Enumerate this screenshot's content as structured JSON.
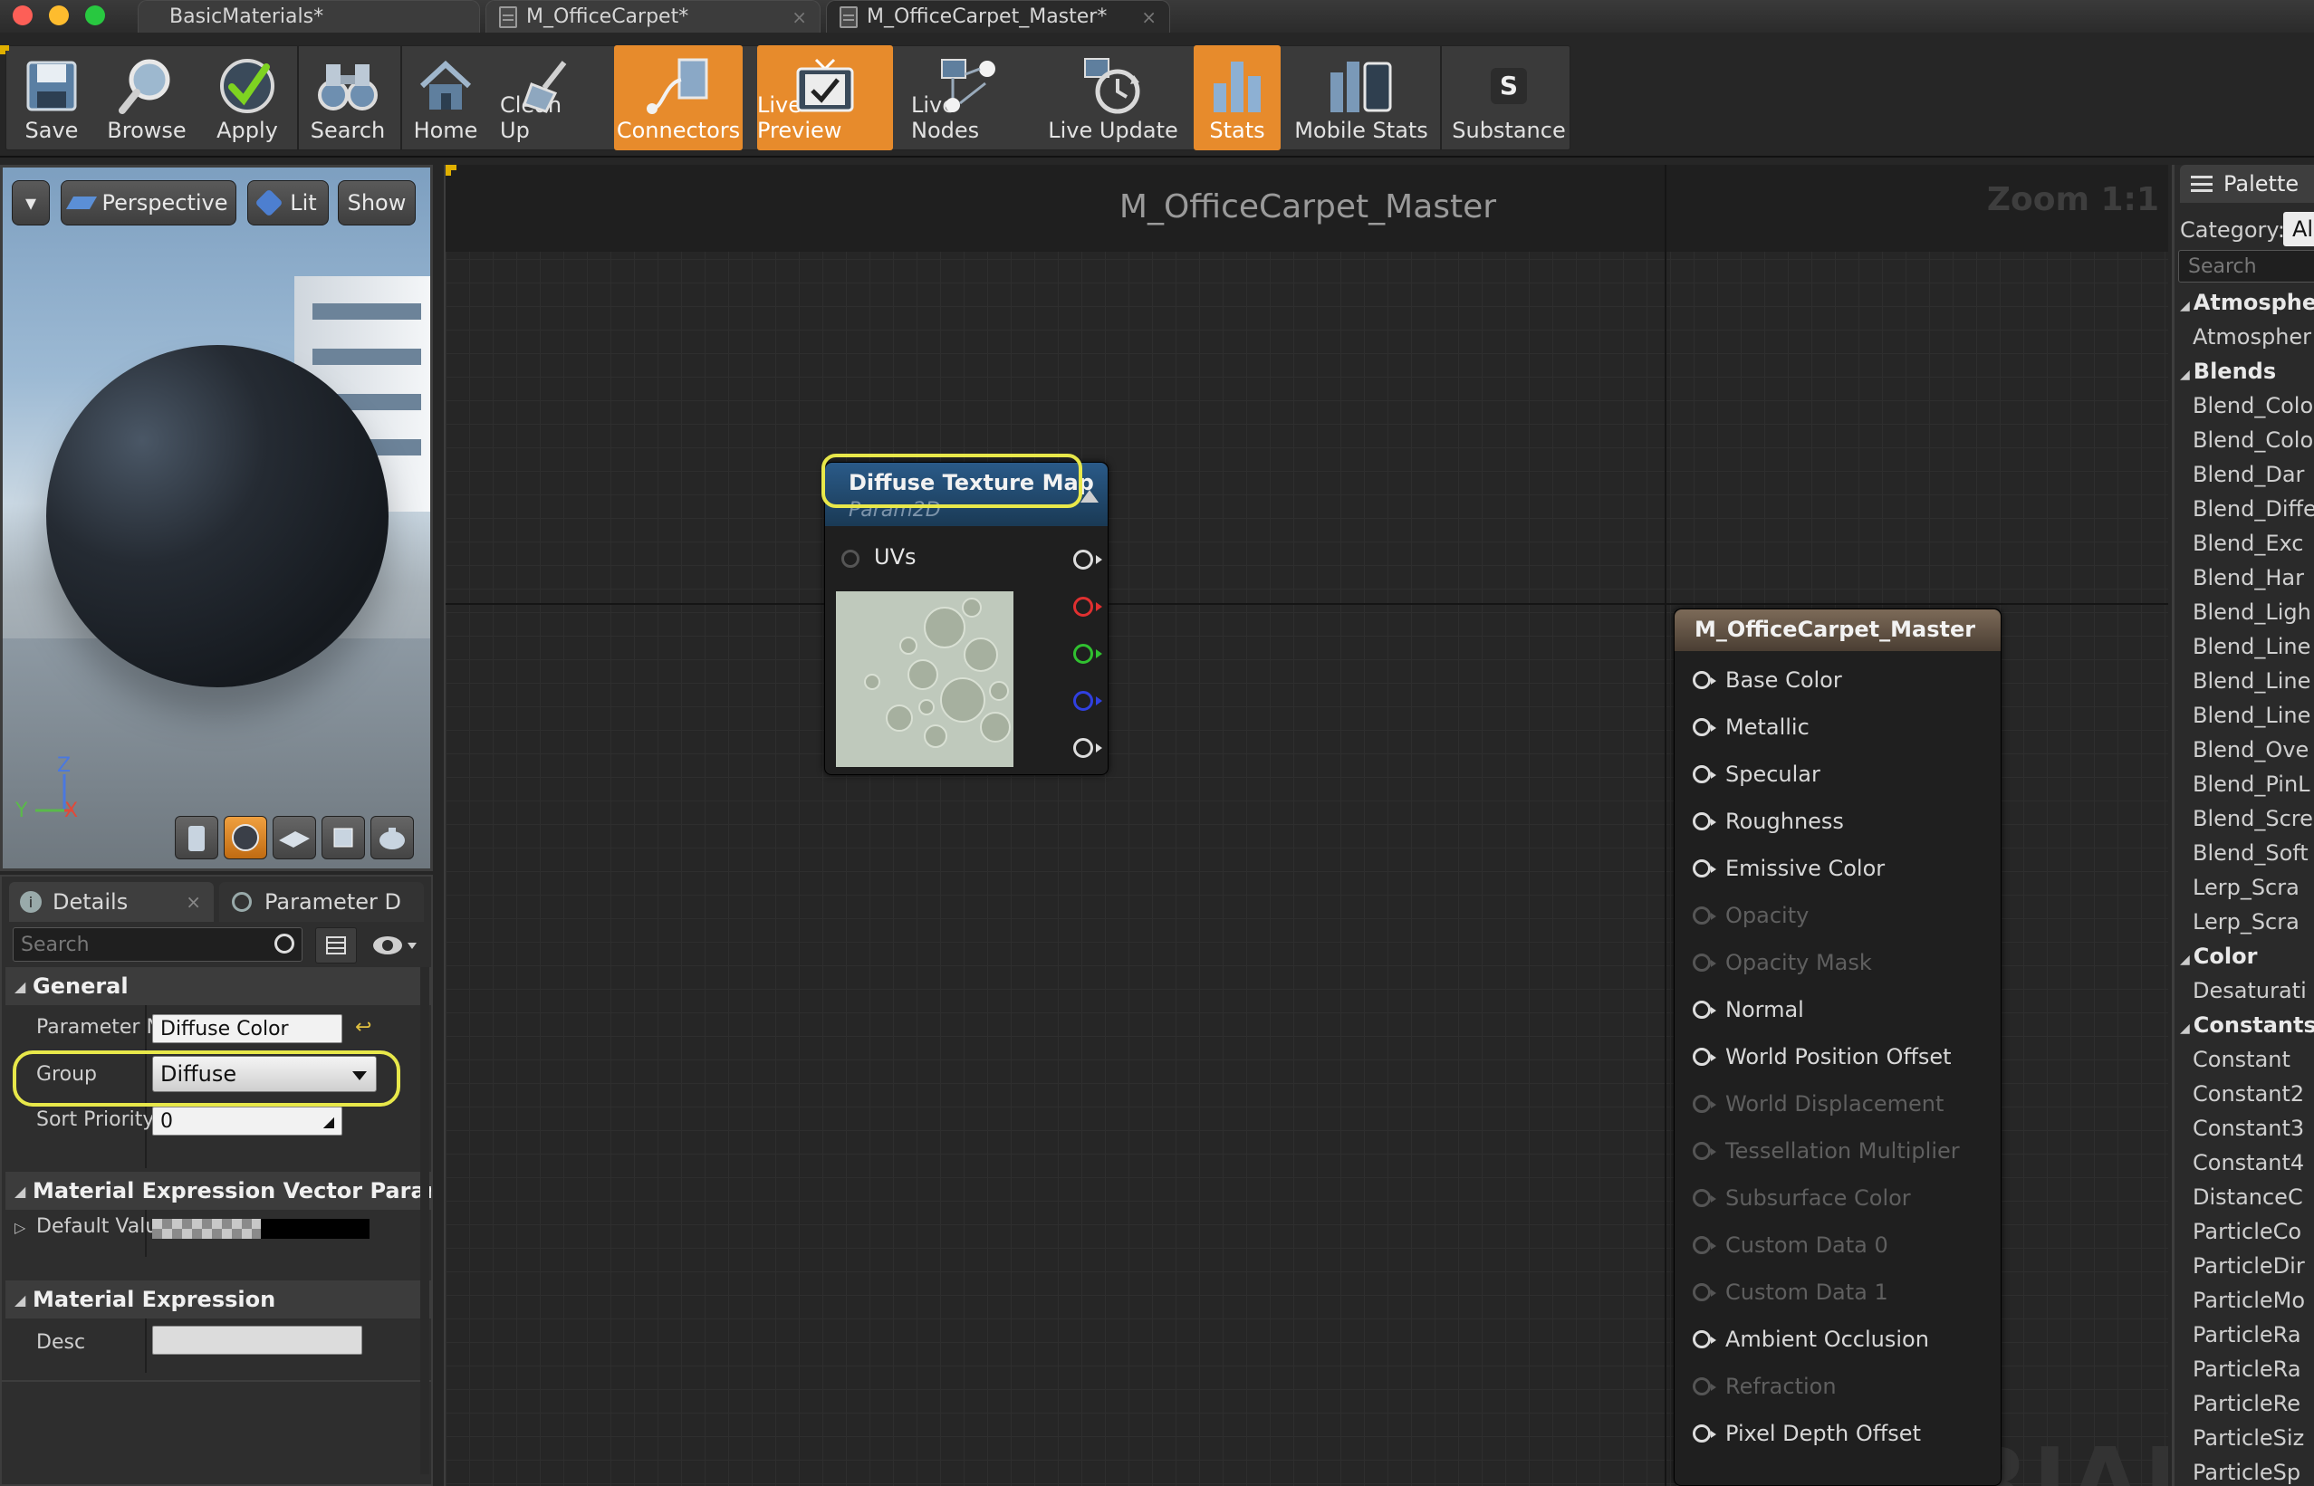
{
  "window": {
    "tabs": [
      {
        "label": "BasicMaterials*"
      },
      {
        "label": "M_OfficeCarpet*"
      },
      {
        "label": "M_OfficeCarpet_Master*"
      }
    ],
    "tab_close": "×"
  },
  "toolbar": {
    "buttons": [
      {
        "label": "Save",
        "icon": "floppy-disk-icon",
        "active": false
      },
      {
        "label": "Browse",
        "icon": "magnifier-icon",
        "active": false
      },
      {
        "label": "Apply",
        "icon": "checkmark-icon",
        "active": false
      },
      {
        "label": "Search",
        "icon": "binoculars-icon",
        "active": false
      },
      {
        "label": "Home",
        "icon": "home-icon",
        "active": false
      },
      {
        "label": "Clean Up",
        "icon": "broom-icon",
        "active": false
      },
      {
        "label": "Connectors",
        "icon": "connectors-icon",
        "active": true
      },
      {
        "label": "Live Preview",
        "icon": "tv-icon",
        "active": true
      },
      {
        "label": "Live Nodes",
        "icon": "live-nodes-icon",
        "active": false
      },
      {
        "label": "Live Update",
        "icon": "live-update-icon",
        "active": false
      },
      {
        "label": "Stats",
        "icon": "bar-chart-icon",
        "active": true
      },
      {
        "label": "Mobile Stats",
        "icon": "mobile-stats-icon",
        "active": false
      },
      {
        "label": "Substance",
        "icon": "substance-icon",
        "active": false
      }
    ],
    "accent": "#e78b2c"
  },
  "viewport": {
    "dropdown_glyph": "▾",
    "perspective_label": "Perspective",
    "lit_label": "Lit",
    "show_label": "Show",
    "axis_z": "Z",
    "axis_y": "Y",
    "axis_x": "X"
  },
  "details": {
    "tabs": [
      {
        "label": "Details"
      },
      {
        "label": "Parameter D"
      }
    ],
    "tab_close": "×",
    "search_placeholder": "Search",
    "general_header": "General",
    "param_name_label": "Parameter N",
    "param_name_value": "Diffuse Color",
    "group_label": "Group",
    "group_value": "Diffuse",
    "sort_priority_label": "Sort Priority",
    "sort_priority_value": "0",
    "vector_header": "Material Expression Vector Parameter",
    "default_value_label": "Default Valu",
    "expression_header": "Material Expression",
    "desc_label": "Desc",
    "desc_value": ""
  },
  "graph": {
    "title": "M_OfficeCarpet_Master",
    "zoom": "Zoom 1:1",
    "watermark": "MATERIAL",
    "texture_node": {
      "title": "Diffuse Texture Map",
      "subtitle": "Param2D",
      "input_label": "UVs",
      "output_colors": [
        "#dddddd",
        "#e03030",
        "#30c030",
        "#3040e0",
        "#dddddd"
      ]
    },
    "result_node": {
      "title": "M_OfficeCarpet_Master",
      "pins": [
        {
          "label": "Base Color",
          "enabled": true
        },
        {
          "label": "Metallic",
          "enabled": true
        },
        {
          "label": "Specular",
          "enabled": true
        },
        {
          "label": "Roughness",
          "enabled": true
        },
        {
          "label": "Emissive Color",
          "enabled": true
        },
        {
          "label": "Opacity",
          "enabled": false
        },
        {
          "label": "Opacity Mask",
          "enabled": false
        },
        {
          "label": "Normal",
          "enabled": true
        },
        {
          "label": "World Position Offset",
          "enabled": true
        },
        {
          "label": "World Displacement",
          "enabled": false
        },
        {
          "label": "Tessellation Multiplier",
          "enabled": false
        },
        {
          "label": "Subsurface Color",
          "enabled": false
        },
        {
          "label": "Custom Data 0",
          "enabled": false
        },
        {
          "label": "Custom Data 1",
          "enabled": false
        },
        {
          "label": "Ambient Occlusion",
          "enabled": true
        },
        {
          "label": "Refraction",
          "enabled": false
        },
        {
          "label": "Pixel Depth Offset",
          "enabled": true
        }
      ]
    },
    "highlight_color": "#e8e84a"
  },
  "palette": {
    "title": "Palette",
    "category_label": "Category:",
    "category_value": "Al",
    "search_placeholder": "Search",
    "entries": [
      {
        "type": "cat",
        "text": "Atmosphere"
      },
      {
        "type": "item",
        "text": "Atmospher"
      },
      {
        "type": "cat",
        "text": "Blends"
      },
      {
        "type": "item",
        "text": "Blend_Colo"
      },
      {
        "type": "item",
        "text": "Blend_Colo"
      },
      {
        "type": "item",
        "text": "Blend_Dar"
      },
      {
        "type": "item",
        "text": "Blend_Diffe"
      },
      {
        "type": "item",
        "text": "Blend_Exc"
      },
      {
        "type": "item",
        "text": "Blend_Har"
      },
      {
        "type": "item",
        "text": "Blend_Ligh"
      },
      {
        "type": "item",
        "text": "Blend_Line"
      },
      {
        "type": "item",
        "text": "Blend_Line"
      },
      {
        "type": "item",
        "text": "Blend_Line"
      },
      {
        "type": "item",
        "text": "Blend_Ove"
      },
      {
        "type": "item",
        "text": "Blend_PinL"
      },
      {
        "type": "item",
        "text": "Blend_Scre"
      },
      {
        "type": "item",
        "text": "Blend_Soft"
      },
      {
        "type": "item",
        "text": "Lerp_Scra"
      },
      {
        "type": "item",
        "text": "Lerp_Scra"
      },
      {
        "type": "cat",
        "text": "Color"
      },
      {
        "type": "item",
        "text": "Desaturati"
      },
      {
        "type": "cat",
        "text": "Constants"
      },
      {
        "type": "item",
        "text": "Constant"
      },
      {
        "type": "item",
        "text": "Constant2"
      },
      {
        "type": "item",
        "text": "Constant3"
      },
      {
        "type": "item",
        "text": "Constant4"
      },
      {
        "type": "item",
        "text": "DistanceC"
      },
      {
        "type": "item",
        "text": "ParticleCo"
      },
      {
        "type": "item",
        "text": "ParticleDir"
      },
      {
        "type": "item",
        "text": "ParticleMo"
      },
      {
        "type": "item",
        "text": "ParticleRa"
      },
      {
        "type": "item",
        "text": "ParticleRa"
      },
      {
        "type": "item",
        "text": "ParticleRe"
      },
      {
        "type": "item",
        "text": "ParticleSiz"
      },
      {
        "type": "item",
        "text": "ParticleSp"
      }
    ]
  }
}
